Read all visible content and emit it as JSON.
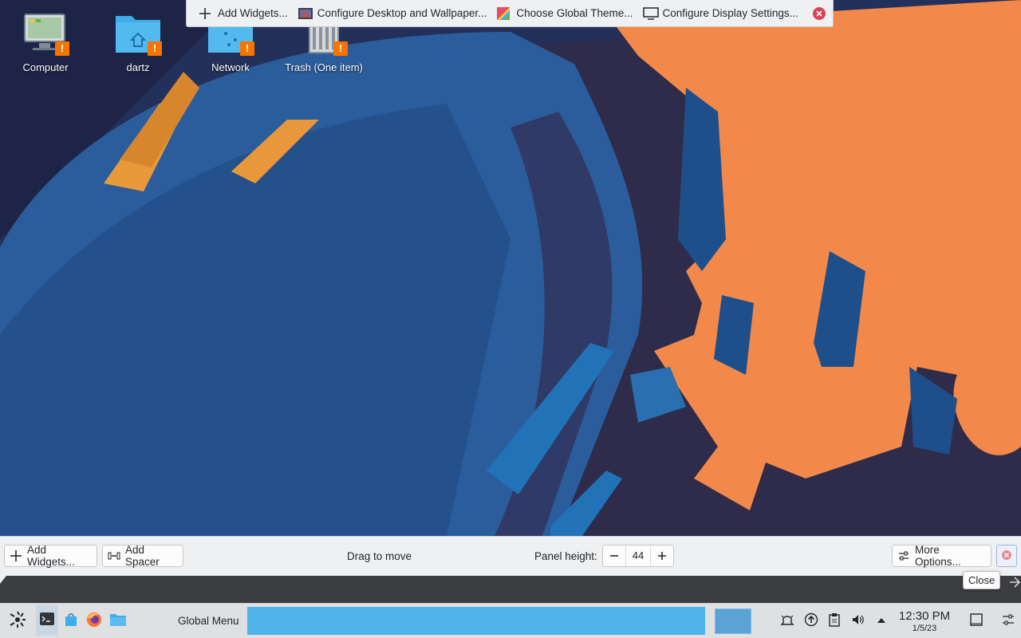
{
  "desktop": {
    "icons": [
      {
        "label": "Computer"
      },
      {
        "label": "dartz"
      },
      {
        "label": "Network"
      },
      {
        "label": "Trash (One item)"
      }
    ],
    "warning_glyph": "!"
  },
  "top_toolbar": {
    "add_widgets": "Add Widgets...",
    "configure_desktop": "Configure Desktop and Wallpaper...",
    "global_theme": "Choose Global Theme...",
    "display_settings": "Configure Display Settings..."
  },
  "panel_config": {
    "add_widgets": "Add Widgets...",
    "add_spacer": "Add Spacer",
    "drag_to_move": "Drag to move",
    "panel_height_label": "Panel height:",
    "panel_height_value": "44",
    "more_options": "More Options...",
    "close_tooltip": "Close"
  },
  "taskbar": {
    "global_menu": "Global Menu",
    "clock_time": "12:30 PM",
    "clock_date": "1/5/23"
  },
  "colors": {
    "accent": "#3daee9",
    "warning": "#f67400",
    "close_red": "#da4453"
  }
}
